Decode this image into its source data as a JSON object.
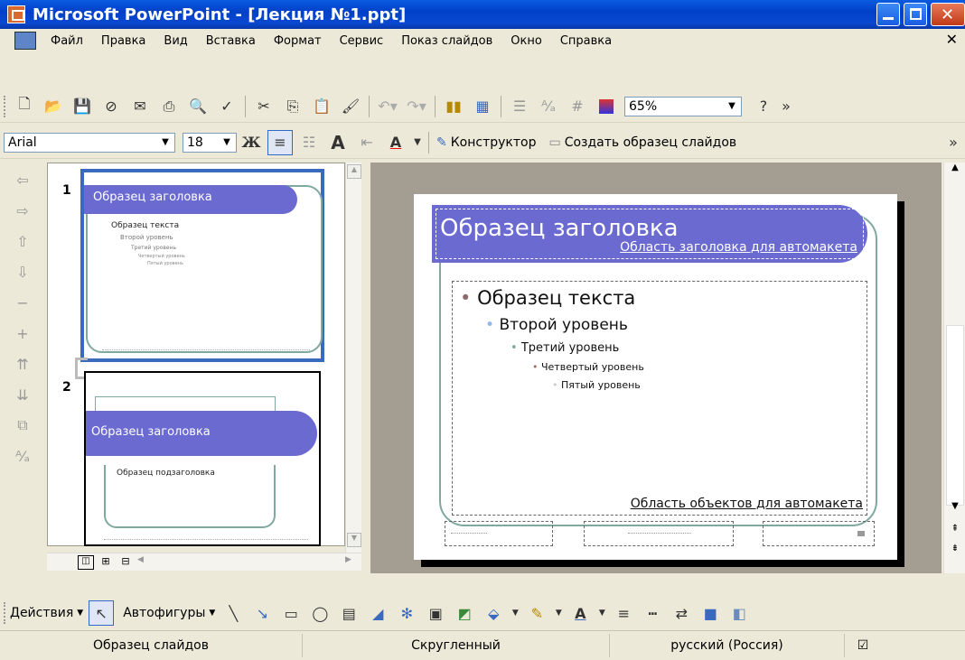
{
  "window": {
    "title": "Microsoft PowerPoint - [Лекция №1.ppt]"
  },
  "menu": {
    "items": [
      "Файл",
      "Правка",
      "Вид",
      "Вставка",
      "Формат",
      "Сервис",
      "Показ слайдов",
      "Окно",
      "Справка"
    ]
  },
  "standard_toolbar": {
    "zoom": "65%"
  },
  "formatting_toolbar": {
    "font": "Arial",
    "size": "18",
    "bold_label": "Ж",
    "constructor_label": "Конструктор",
    "create_master_label": "Создать образец слайдов"
  },
  "thumbnails": [
    {
      "number": "1",
      "title": "Образец заголовка",
      "text": "Образец текста",
      "level2": "Второй уровень",
      "level3": "Третий уровень",
      "level4": "Четвертый уровень",
      "level5": "Пятый уровень"
    },
    {
      "number": "2",
      "title": "Образец заголовка",
      "subtitle": "Образец подзаголовка"
    }
  ],
  "slide": {
    "title": "Образец заголовка",
    "title_area_caption": "Область заголовка для автомакета",
    "level1": "Образец текста",
    "level2": "Второй уровень",
    "level3": "Третий уровень",
    "level4": "Четвертый уровень",
    "level5": "Пятый уровень",
    "object_area_caption": "Область объектов для автомакета"
  },
  "drawing_toolbar": {
    "actions_label": "Действия",
    "autoshapes_label": "Автофигуры"
  },
  "status": {
    "view": "Образец слайдов",
    "design": "Скругленный",
    "language": "русский (Россия)"
  },
  "colors": {
    "title_band": "#6A6AD0",
    "bullet_accent": "#8FB8E8",
    "frame_teal": "#7FA9A0",
    "workspace": "#A49E92"
  }
}
